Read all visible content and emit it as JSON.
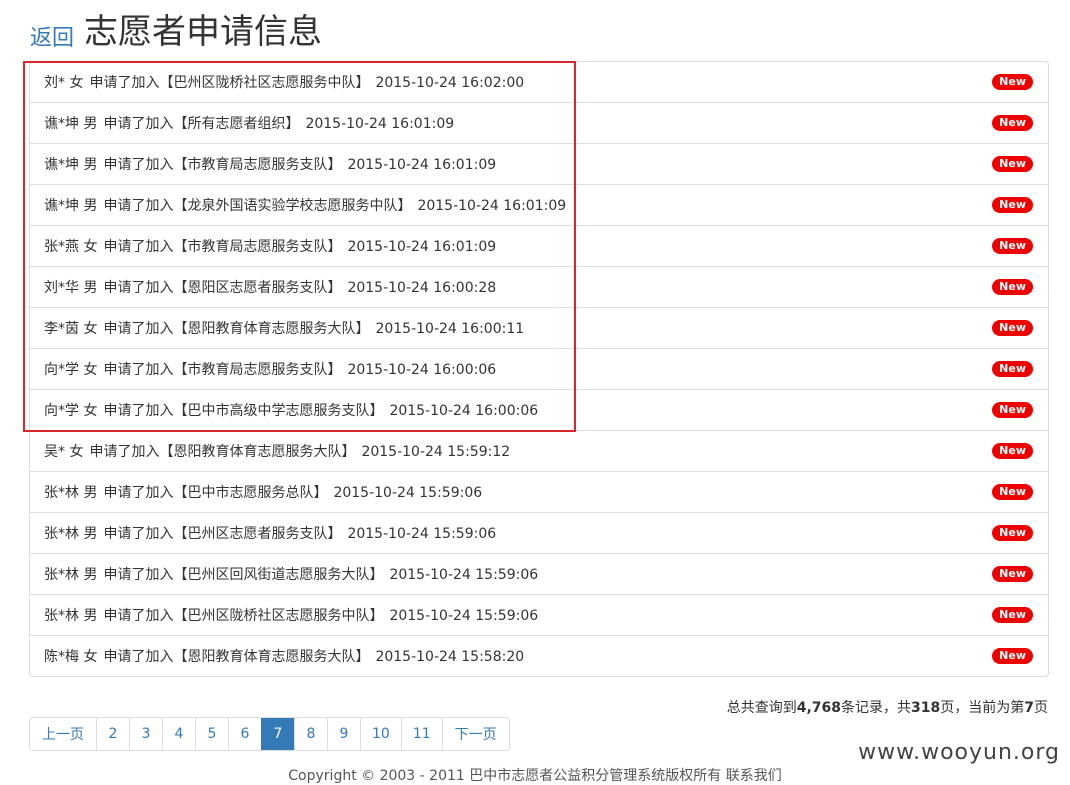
{
  "header": {
    "back": "返回",
    "title": "志愿者申请信息"
  },
  "badge_label": "New",
  "items": [
    {
      "name": "刘* 女",
      "action": "申请了加入【巴州区陇桥社区志愿服务中队】",
      "time": "2015-10-24 16:02:00"
    },
    {
      "name": "谯*坤 男",
      "action": "申请了加入【所有志愿者组织】",
      "time": "2015-10-24 16:01:09"
    },
    {
      "name": "谯*坤 男",
      "action": "申请了加入【市教育局志愿服务支队】",
      "time": "2015-10-24 16:01:09"
    },
    {
      "name": "谯*坤 男",
      "action": "申请了加入【龙泉外国语实验学校志愿服务中队】",
      "time": "2015-10-24 16:01:09"
    },
    {
      "name": "张*燕 女",
      "action": "申请了加入【市教育局志愿服务支队】",
      "time": "2015-10-24 16:01:09"
    },
    {
      "name": "刘*华 男",
      "action": "申请了加入【恩阳区志愿者服务支队】",
      "time": "2015-10-24 16:00:28"
    },
    {
      "name": "李*茵 女",
      "action": "申请了加入【恩阳教育体育志愿服务大队】",
      "time": "2015-10-24 16:00:11"
    },
    {
      "name": "向*学 女",
      "action": "申请了加入【市教育局志愿服务支队】",
      "time": "2015-10-24 16:00:06"
    },
    {
      "name": "向*学 女",
      "action": "申请了加入【巴中市高级中学志愿服务支队】",
      "time": "2015-10-24 16:00:06"
    },
    {
      "name": "吴* 女",
      "action": "申请了加入【恩阳教育体育志愿服务大队】",
      "time": "2015-10-24 15:59:12"
    },
    {
      "name": "张*林 男",
      "action": "申请了加入【巴中市志愿服务总队】",
      "time": "2015-10-24 15:59:06"
    },
    {
      "name": "张*林 男",
      "action": "申请了加入【巴州区志愿者服务支队】",
      "time": "2015-10-24 15:59:06"
    },
    {
      "name": "张*林 男",
      "action": "申请了加入【巴州区回风街道志愿服务大队】",
      "time": "2015-10-24 15:59:06"
    },
    {
      "name": "张*林 男",
      "action": "申请了加入【巴州区陇桥社区志愿服务中队】",
      "time": "2015-10-24 15:59:06"
    },
    {
      "name": "陈*梅 女",
      "action": "申请了加入【恩阳教育体育志愿服务大队】",
      "time": "2015-10-24 15:58:20"
    }
  ],
  "summary": {
    "prefix": "总共查询到",
    "records": "4,768",
    "mid1": "条记录，共",
    "pages": "318",
    "mid2": "页，当前为第",
    "current": "7",
    "suffix": "页"
  },
  "pagination": {
    "prev": "上一页",
    "pages": [
      "2",
      "3",
      "4",
      "5",
      "6",
      "7",
      "8",
      "9",
      "10",
      "11"
    ],
    "active": "7",
    "next": "下一页"
  },
  "watermark": "www.wooyun.org",
  "footer": "Copyright © 2003 - 2011 巴中市志愿者公益积分管理系统版权所有 联系我们",
  "colors": {
    "link": "#337ab7",
    "badge": "#ee0000",
    "highlight": "#d9262c"
  }
}
